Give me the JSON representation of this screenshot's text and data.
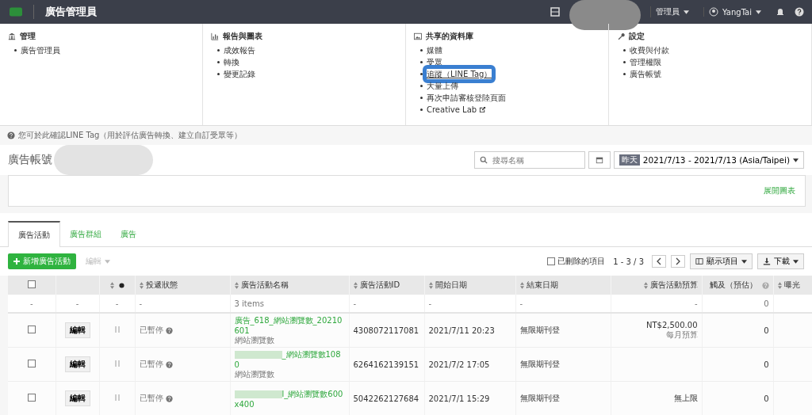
{
  "top_bar": {
    "title": "廣告管理員",
    "role": "管理員",
    "user": "YangTai"
  },
  "menu": [
    {
      "kind": "bank",
      "heading": "管理",
      "items": [
        {
          "label": "廣告管理員",
          "highlighted": false,
          "external": false
        }
      ]
    },
    {
      "kind": "chart",
      "heading": "報告與圖表",
      "items": [
        {
          "label": "成效報告",
          "highlighted": false,
          "external": false
        },
        {
          "label": "轉換",
          "highlighted": false,
          "external": false
        },
        {
          "label": "變更記錄",
          "highlighted": false,
          "external": false
        }
      ]
    },
    {
      "kind": "image",
      "heading": "共享的資料庫",
      "items": [
        {
          "label": "媒體",
          "highlighted": false,
          "external": false
        },
        {
          "label": "受眾",
          "highlighted": false,
          "external": false
        },
        {
          "label": "追蹤（LINE Tag）",
          "highlighted": true,
          "external": false
        },
        {
          "label": "大量上傳",
          "highlighted": false,
          "external": false
        },
        {
          "label": "再次申請審核登陸頁面",
          "highlighted": false,
          "external": false
        },
        {
          "label": "Creative Lab",
          "highlighted": false,
          "external": true
        }
      ]
    },
    {
      "kind": "wrench",
      "heading": "設定",
      "items": [
        {
          "label": "收費與付款",
          "highlighted": false,
          "external": false
        },
        {
          "label": "管理權限",
          "highlighted": false,
          "external": false
        },
        {
          "label": "廣告帳號",
          "highlighted": false,
          "external": false
        }
      ]
    }
  ],
  "hint": "您可於此確認LINE Tag（用於評估廣告轉換、建立自訂受眾等）",
  "account": {
    "title": "廣告帳號"
  },
  "search": {
    "placeholder": "搜尋名稱"
  },
  "date_range": {
    "badge": "昨天",
    "value": "2021/7/13 - 2021/7/13 (Asia/Taipei)"
  },
  "chart_panel": {
    "link": "展開圖表"
  },
  "tabs": [
    {
      "label": "廣告活動",
      "selected": true
    },
    {
      "label": "廣告群組",
      "selected": false
    },
    {
      "label": "廣告",
      "selected": false
    }
  ],
  "toolbar": {
    "create": "新增廣告活動",
    "edit": {
      "label": "編輯",
      "disabled": true
    },
    "show_deleted": {
      "label": "已刪除的項目",
      "checked": false
    },
    "pagination": "1 - 3 / 3",
    "columns": "顯示項目",
    "download": "下載"
  },
  "table": {
    "select_all": false,
    "columns": [
      "",
      "",
      "",
      "投遞狀態",
      "廣告活動名稱",
      "廣告活動ID",
      "開始日期",
      "結束日期",
      "廣告活動預算",
      "觸及（預估）",
      "曝光"
    ],
    "summary": [
      "-",
      "-",
      "-",
      "-",
      "3 items",
      "-",
      "-",
      "-",
      "-",
      "0"
    ],
    "rows": [
      {
        "checked": false,
        "edit": "編輯",
        "on": false,
        "status": "已暫停",
        "name": "廣告_618_網站瀏覽數_20210601",
        "redacted": false,
        "objective": "網站瀏覽數",
        "id": "4308072117081",
        "start": "2021/7/11 20:23",
        "end": "無限期刊登",
        "budget": "NT$2,500.00",
        "budget_note": "每月預算",
        "reach": "0"
      },
      {
        "checked": false,
        "edit": "編輯",
        "on": false,
        "status": "已暫停",
        "name": "_網站瀏覽數1080",
        "redacted": true,
        "objective": "網站瀏覽數",
        "id": "6264162139151",
        "start": "2021/7/2 17:05",
        "end": "無限期刊登",
        "budget": "",
        "budget_note": "",
        "reach": "0"
      },
      {
        "checked": false,
        "edit": "編輯",
        "on": false,
        "status": "已暫停",
        "name": "l_網站瀏覽數600x400",
        "redacted": true,
        "objective": "",
        "id": "5042262127684",
        "start": "2021/7/1 15:29",
        "end": "無限期刊登",
        "budget": "無上限",
        "budget_note": "",
        "reach": "0"
      }
    ]
  }
}
